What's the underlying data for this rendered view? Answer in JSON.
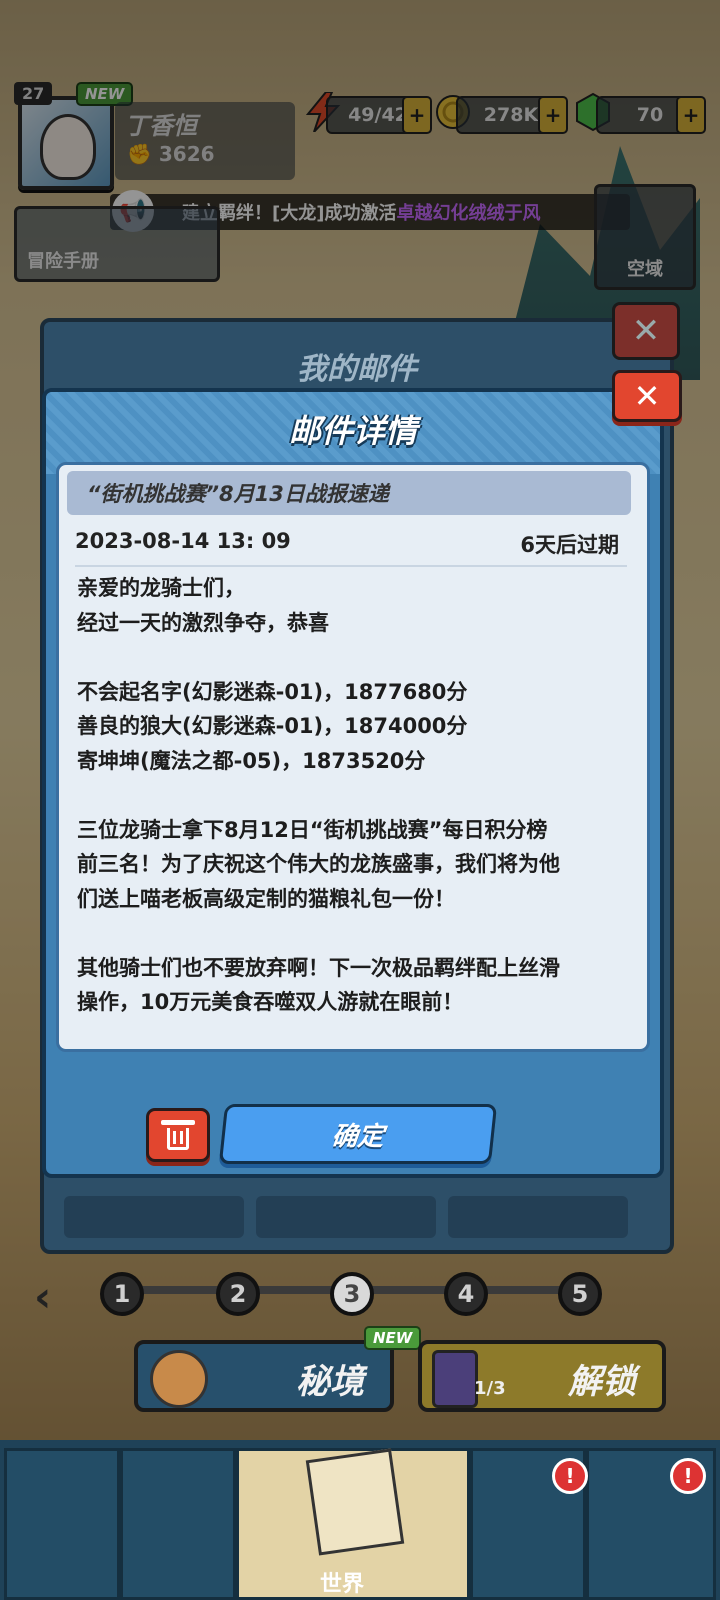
{
  "player": {
    "level": "27",
    "new_tag": "NEW",
    "name": "丁香恒",
    "power": "3626"
  },
  "resources": {
    "energy": "49/42",
    "coins": "278K",
    "gems": "70"
  },
  "broadcast": {
    "text": "建立羁绊！[大龙]成功激活",
    "highlight": "卓越幻化绒绒于风"
  },
  "side": {
    "handbook_label": "冒险手册",
    "airspace_label": "空域"
  },
  "mailbox": {
    "title": "我的邮件"
  },
  "mail_detail": {
    "title": "邮件详情",
    "subject": "“街机挑战赛”8月13日战报速递",
    "date": "2023-08-14 13: 09",
    "expire": "6天后过期",
    "body": {
      "l1": "亲爱的龙骑士们，",
      "l2": "经过一天的激烈争夺，恭喜",
      "l3": "不会起名字(幻影迷森-01)，1877680分",
      "l4": "善良的狼大(幻影迷森-01)，1874000分",
      "l5": "寄坤坤(魔法之都-05)，1873520分",
      "l6": "三位龙骑士拿下8月12日“街机挑战赛”每日积分榜",
      "l7": "前三名！为了庆祝这个伟大的龙族盛事，我们将为他",
      "l8": "们送上喵老板高级定制的猫粮礼包一份！",
      "l9": "其他骑士们也不要放弃啊！下一次极品羁绊配上丝滑",
      "l10": "操作，10万元美食吞噬双人游就在眼前！"
    },
    "confirm_label": "确定"
  },
  "pager": [
    "1",
    "2",
    "3",
    "4",
    "5"
  ],
  "bottom_buttons": {
    "secret_label": "秘境",
    "secret_new": "NEW",
    "unlock_label": "解锁",
    "unlock_count": "1/3"
  },
  "nav": {
    "world_label": "世界",
    "badge": "!"
  },
  "colors": {
    "dialog": "#3f81b3",
    "confirm": "#4a9ef0",
    "danger": "#e2462f",
    "highlight": "#c86cff"
  }
}
